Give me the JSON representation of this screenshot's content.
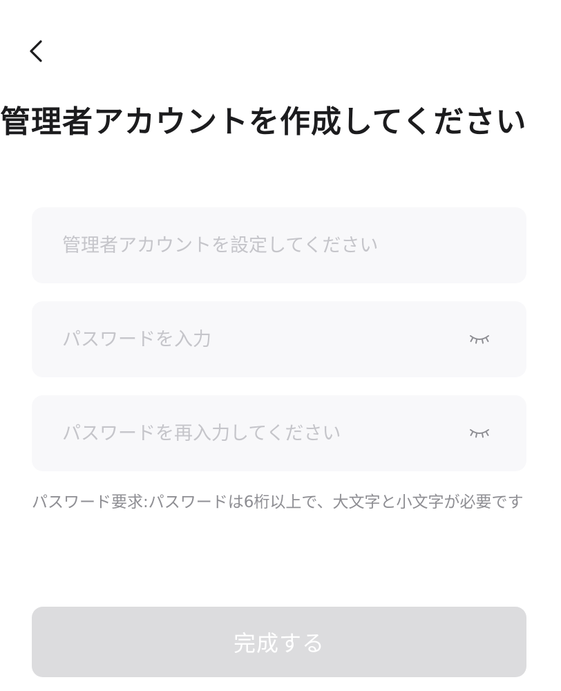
{
  "header": {
    "back_icon": "chevron-left-icon",
    "title": "管理者アカウントを作成してください"
  },
  "form": {
    "account": {
      "value": "",
      "placeholder": "管理者アカウントを設定してください"
    },
    "password": {
      "value": "",
      "placeholder": "パスワードを入力",
      "toggle_icon": "eye-closed-icon"
    },
    "confirm_password": {
      "value": "",
      "placeholder": "パスワードを再入力してください",
      "toggle_icon": "eye-closed-icon"
    },
    "hint": "パスワード要求:パスワードは6桁以上で、大文字と小文字が必要です"
  },
  "submit": {
    "label": "完成する",
    "enabled": false
  },
  "colors": {
    "field_background": "#f8f8fa",
    "placeholder": "#c5c5ca",
    "hint_text": "#8e8e93",
    "button_disabled_background": "#dcdcde",
    "button_text": "#ffffff",
    "title_text": "#1c1c1e"
  }
}
